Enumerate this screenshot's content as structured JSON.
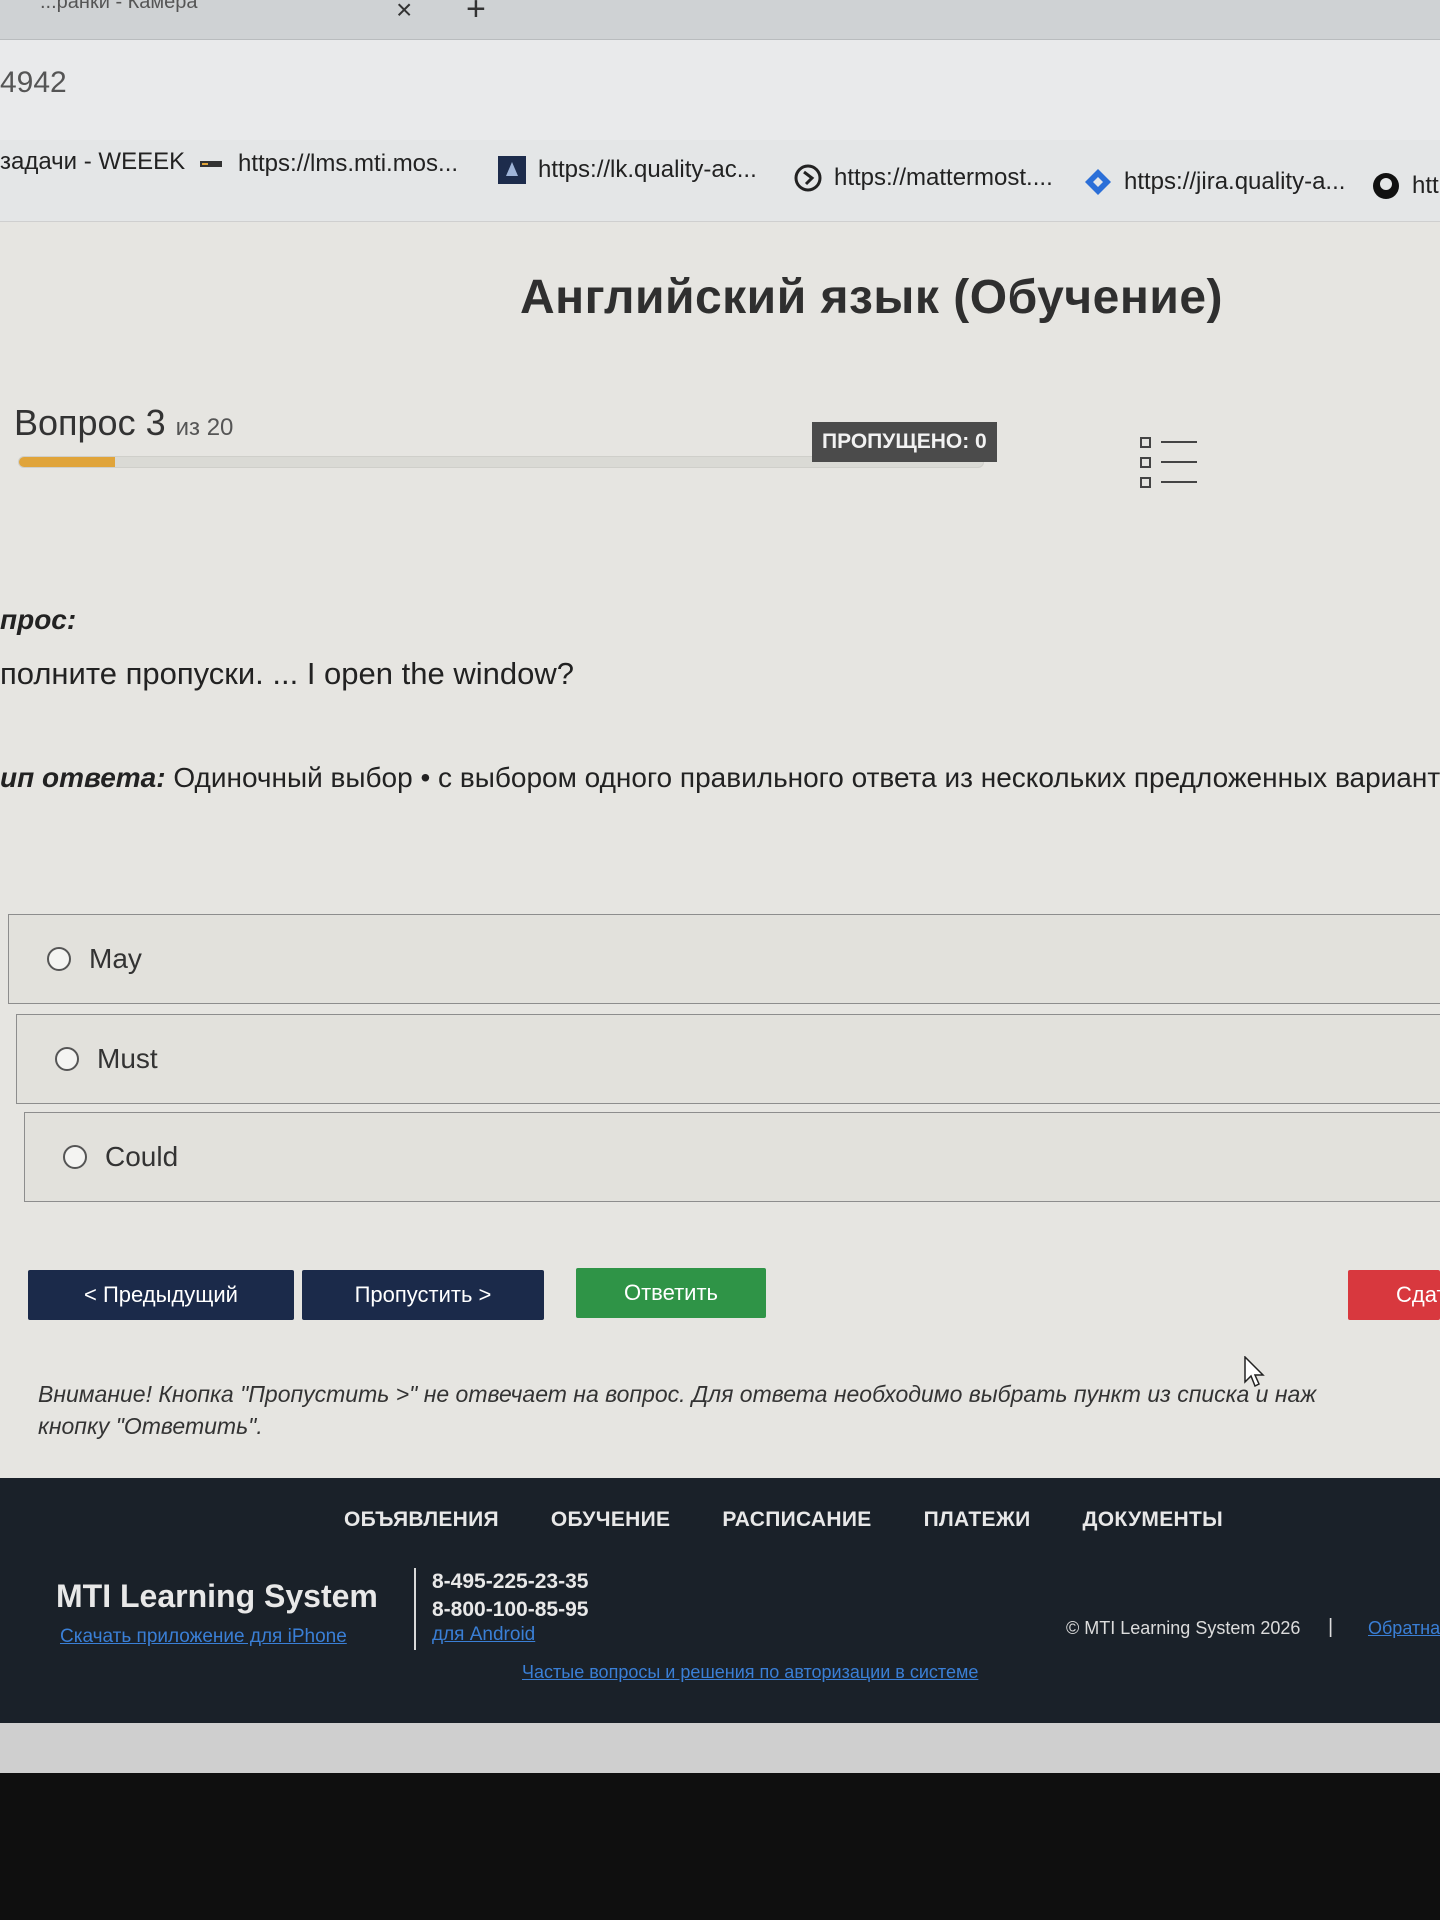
{
  "browser": {
    "tab": {
      "title": "...ранки - Камера"
    },
    "address": "4942",
    "bookmarks": [
      {
        "label": "задачи - WEEEK",
        "icon": "weeek-icon"
      },
      {
        "label": "https://lms.mti.mos...",
        "icon": "lms-icon"
      },
      {
        "label": "https://lk.quality-ac...",
        "icon": "quality-icon"
      },
      {
        "label": "https://mattermost....",
        "icon": "mattermost-icon"
      },
      {
        "label": "https://jira.quality-a...",
        "icon": "jira-icon"
      },
      {
        "label": "htt",
        "icon": "github-icon"
      }
    ]
  },
  "page": {
    "course_title": "Английский язык (Обучение)",
    "question": {
      "counter_label": "Вопрос 3",
      "counter_of": "из 20",
      "progress_fraction": 0.1,
      "skipped_badge": "ПРОПУЩЕНО: 0",
      "label": "прос:",
      "text": "полните пропуски. ... I open the window?",
      "answer_type_label": "ип ответа:",
      "answer_type_value": "Одиночный выбор • с выбором одного правильного ответа из нескольких предложенных вариант"
    },
    "options": [
      {
        "label": "May"
      },
      {
        "label": "Must"
      },
      {
        "label": "Could"
      }
    ],
    "buttons": {
      "prev": "< Предыдущий",
      "skip": "Пропустить >",
      "answer": "Ответить",
      "submit": "Сдат"
    },
    "warning": {
      "line1": "Внимание! Кнопка \"Пропустить >\" не отвечает на вопрос. Для ответа необходимо выбрать пункт из списка и наж",
      "line2": "кнопку \"Ответить\"."
    }
  },
  "footer": {
    "nav": [
      "ОБЪЯВЛЕНИЯ",
      "ОБУЧЕНИЕ",
      "РАСПИСАНИЕ",
      "ПЛАТЕЖИ",
      "ДОКУМЕНТЫ"
    ],
    "brand": "MTI Learning System",
    "iphone_link": "Скачать приложение для iPhone",
    "phone1": "8-495-225-23-35",
    "phone2": "8-800-100-85-95",
    "android_link": "для Android",
    "copyright": "© MTI Learning System 2026",
    "separator": "|",
    "more_link": "Обратная",
    "faq_link": "Частые вопросы и решения по авторизации в системе"
  },
  "colors": {
    "progress_fill": "#e0a43a",
    "navy_button": "#1b2a4a",
    "green_button": "#2f9447",
    "red_button": "#d8383e",
    "footer_bg": "#1a2129",
    "link": "#3a7fd6"
  }
}
